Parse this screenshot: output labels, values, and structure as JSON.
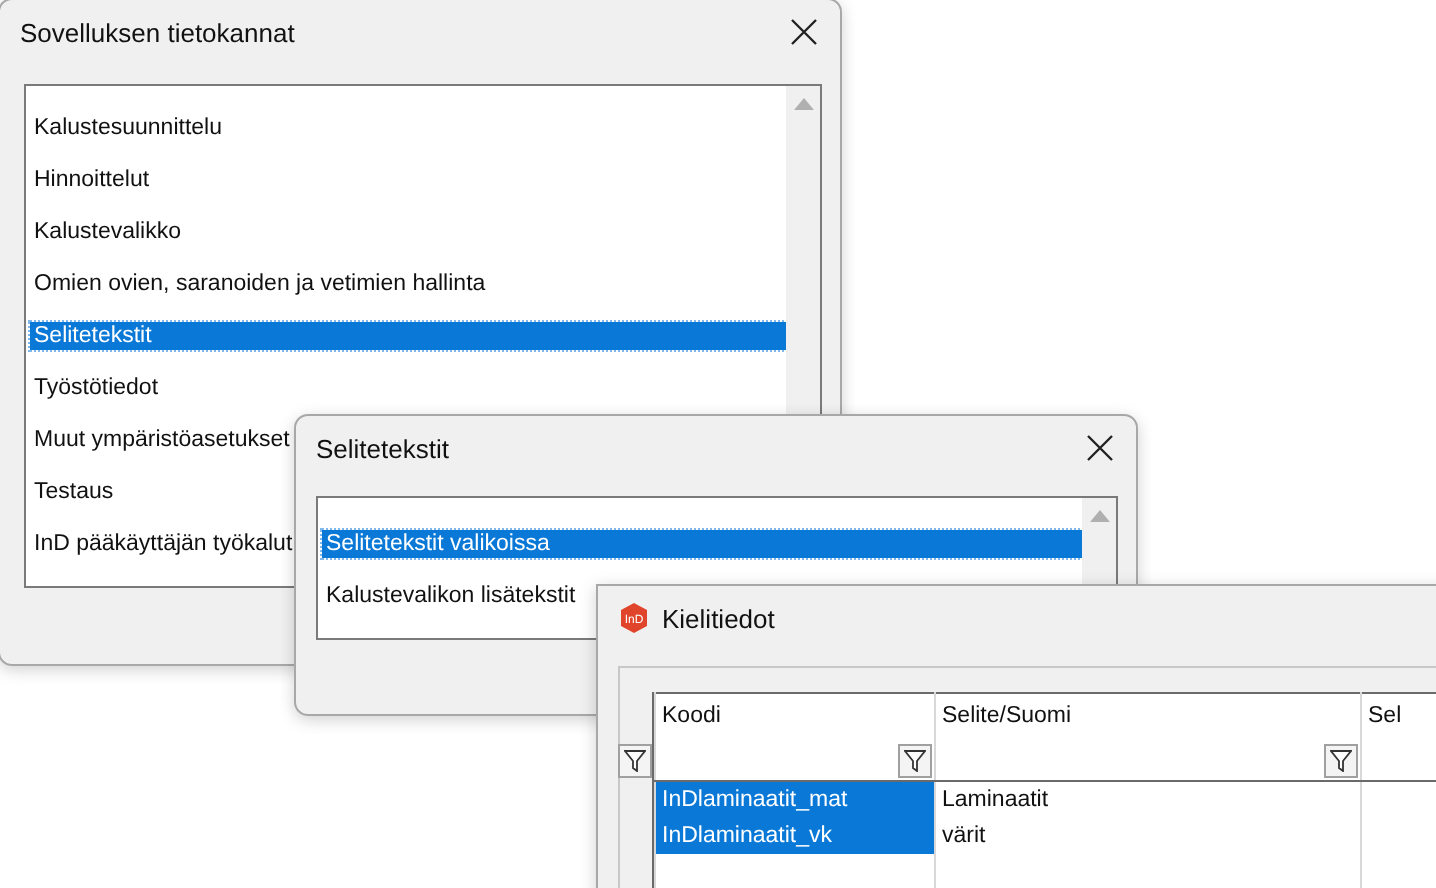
{
  "windows": [
    {
      "kind": "list",
      "title": "Sovelluksen tietokannat",
      "closable": true,
      "items": [
        {
          "label": "Kalustesuunnittelu",
          "selected": false
        },
        {
          "label": "Hinnoittelut",
          "selected": false
        },
        {
          "label": "Kalustevalikko",
          "selected": false
        },
        {
          "label": "Omien ovien, saranoiden ja vetimien hallinta",
          "selected": false
        },
        {
          "label": "Selitetekstit",
          "selected": true
        },
        {
          "label": "Työstötiedot",
          "selected": false
        },
        {
          "label": "Muut ympäristöasetukset",
          "selected": false
        },
        {
          "label": "Testaus",
          "selected": false
        },
        {
          "label": "InD pääkäyttäjän työkalut",
          "selected": false
        }
      ]
    },
    {
      "kind": "list",
      "title": "Selitetekstit",
      "closable": true,
      "items": [
        {
          "label": "Selitetekstit valikoissa",
          "selected": true
        },
        {
          "label": "Kalustevalikon lisätekstit",
          "selected": false
        }
      ]
    },
    {
      "kind": "grid",
      "title": "Kielitiedot",
      "app_icon_label": "InD",
      "columns": [
        {
          "label": "Koodi",
          "filter": true
        },
        {
          "label": "Selite/Suomi",
          "filter": true
        },
        {
          "label": "Sel"
        }
      ],
      "rows": [
        {
          "cells": [
            "InDlaminaatit_mat",
            "Laminaatit"
          ],
          "selected": true
        },
        {
          "cells": [
            "InDlaminaatit_vk",
            "värit"
          ],
          "selected": true
        }
      ]
    }
  ]
}
